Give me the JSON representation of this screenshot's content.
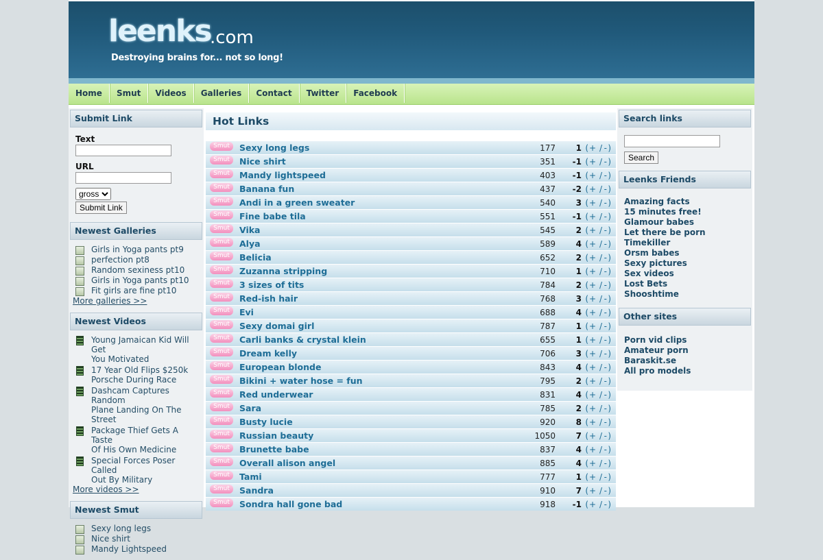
{
  "header": {
    "logo_main": "leenks",
    "logo_domain": ".com",
    "tagline": "Destroying brains for... not so long!"
  },
  "nav": [
    "Home",
    "Smut",
    "Videos",
    "Galleries",
    "Contact",
    "Twitter",
    "Facebook"
  ],
  "submit": {
    "title": "Submit Link",
    "text_label": "Text",
    "url_label": "URL",
    "category_value": "gross",
    "button": "Submit Link"
  },
  "galleries": {
    "title": "Newest Galleries",
    "items": [
      "Girls in Yoga pants pt9",
      "perfection pt8",
      "Random sexiness pt10",
      "Girls in Yoga pants pt10",
      "Fit girls are fine pt10"
    ],
    "more": "More galleries >>"
  },
  "videos": {
    "title": "Newest Videos",
    "items": [
      [
        "Young Jamaican Kid Will Get",
        "You Motivated"
      ],
      [
        "17 Year Old Flips $250k",
        "Porsche During Race"
      ],
      [
        "Dashcam Captures Random",
        "Plane Landing On The Street"
      ],
      [
        "Package Thief Gets A Taste",
        "Of His Own Medicine"
      ],
      [
        "Special Forces Poser Called",
        "Out By Military"
      ]
    ],
    "more": "More videos >>"
  },
  "smut": {
    "title": "Newest Smut",
    "items": [
      "Sexy long legs",
      "Nice shirt",
      "Mandy Lightspeed"
    ]
  },
  "hot": {
    "title": "Hot Links",
    "tag": "Smut",
    "vote_open": "(",
    "vote_plus": "+",
    "vote_sep": "/",
    "vote_minus": "-",
    "vote_close": ")",
    "rows": [
      {
        "title": "Sexy long legs",
        "views": "177",
        "score": "1"
      },
      {
        "title": "Nice shirt",
        "views": "351",
        "score": "-1"
      },
      {
        "title": "Mandy lightspeed",
        "views": "403",
        "score": "-1"
      },
      {
        "title": "Banana fun",
        "views": "437",
        "score": "-2"
      },
      {
        "title": "Andi in a green sweater",
        "views": "540",
        "score": "3"
      },
      {
        "title": "Fine babe tila",
        "views": "551",
        "score": "-1"
      },
      {
        "title": "Vika",
        "views": "545",
        "score": "2"
      },
      {
        "title": "Alya",
        "views": "589",
        "score": "4"
      },
      {
        "title": "Belicia",
        "views": "652",
        "score": "2"
      },
      {
        "title": "Zuzanna stripping",
        "views": "710",
        "score": "1"
      },
      {
        "title": "3 sizes of tits",
        "views": "784",
        "score": "2"
      },
      {
        "title": "Red-ish hair",
        "views": "768",
        "score": "3"
      },
      {
        "title": "Evi",
        "views": "688",
        "score": "4"
      },
      {
        "title": "Sexy domai girl",
        "views": "787",
        "score": "1"
      },
      {
        "title": "Carli banks & crystal klein",
        "views": "655",
        "score": "1"
      },
      {
        "title": "Dream kelly",
        "views": "706",
        "score": "3"
      },
      {
        "title": "European blonde",
        "views": "843",
        "score": "4"
      },
      {
        "title": "Bikini + water hose = fun",
        "views": "795",
        "score": "2"
      },
      {
        "title": "Red underwear",
        "views": "831",
        "score": "4"
      },
      {
        "title": "Sara",
        "views": "785",
        "score": "2"
      },
      {
        "title": "Busty lucie",
        "views": "920",
        "score": "8"
      },
      {
        "title": "Russian beauty",
        "views": "1050",
        "score": "7"
      },
      {
        "title": "Brunette babe",
        "views": "837",
        "score": "4"
      },
      {
        "title": "Overall alison angel",
        "views": "885",
        "score": "4"
      },
      {
        "title": "Tami",
        "views": "777",
        "score": "1"
      },
      {
        "title": "Sandra",
        "views": "910",
        "score": "7"
      },
      {
        "title": "Sondra hall gone bad",
        "views": "918",
        "score": "-1"
      }
    ]
  },
  "search": {
    "title": "Search links",
    "button": "Search"
  },
  "friends": {
    "title": "Leenks Friends",
    "items": [
      "Amazing facts",
      "15 minutes free!",
      "Glamour babes",
      "Let there be porn",
      "Timekiller",
      "Orsm babes",
      "Sexy pictures",
      "Sex videos",
      "Lost Bets",
      "Shooshtime"
    ]
  },
  "other": {
    "title": "Other sites",
    "items": [
      "Porn vid clips",
      "Amateur porn",
      "Baraskit.se",
      "All pro models"
    ]
  }
}
